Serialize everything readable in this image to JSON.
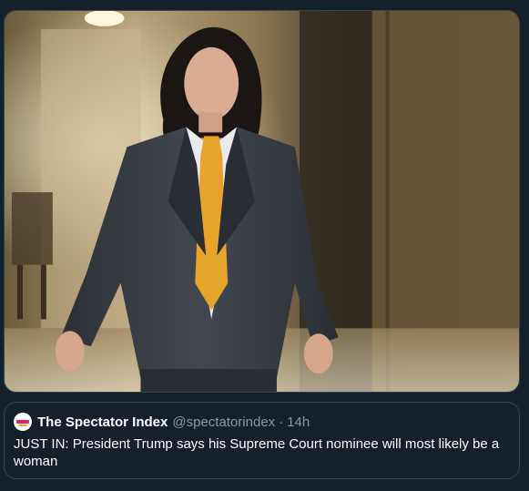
{
  "media": {
    "icon": "photo-of-woman-in-suit-walking-hallway"
  },
  "quote": {
    "display_name": "The Spectator Index",
    "handle": "@spectatorindex",
    "separator": "·",
    "timestamp": "14h",
    "text": "JUST IN: President Trump says his Supreme Court nominee will most likely be a woman",
    "avatar_icon": "spectator-index-logo-icon"
  },
  "colors": {
    "background": "#15202b",
    "border": "#38444d",
    "text_primary": "#ffffff",
    "text_secondary": "#8899a6"
  }
}
